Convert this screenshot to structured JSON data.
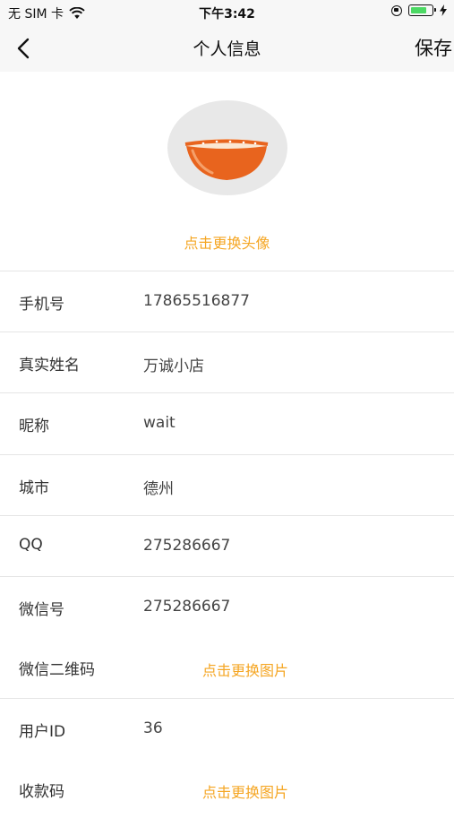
{
  "status_bar": {
    "carrier": "无 SIM 卡",
    "time": "下午3:42"
  },
  "nav": {
    "title": "个人信息",
    "save_label": "保存"
  },
  "avatar": {
    "change_label": "点击更换头像"
  },
  "form": {
    "phone": {
      "label": "手机号",
      "value": "17865516877"
    },
    "real_name": {
      "label": "真实姓名",
      "value": "万诚小店"
    },
    "nickname": {
      "label": "昵称",
      "value": "wait"
    },
    "city": {
      "label": "城市",
      "value": "德州"
    },
    "qq": {
      "label": "QQ",
      "value": "275286667"
    },
    "wechat_id": {
      "label": "微信号",
      "value": "275286667"
    },
    "wechat_qr": {
      "label": "微信二维码",
      "link": "点击更换图片"
    },
    "user_id": {
      "label": "用户ID",
      "value": "36"
    },
    "payment_code": {
      "label": "收款码",
      "link": "点击更换图片"
    }
  },
  "colors": {
    "accent": "#f5a623",
    "bowl": "#e8641e",
    "battery": "#4cd964"
  }
}
